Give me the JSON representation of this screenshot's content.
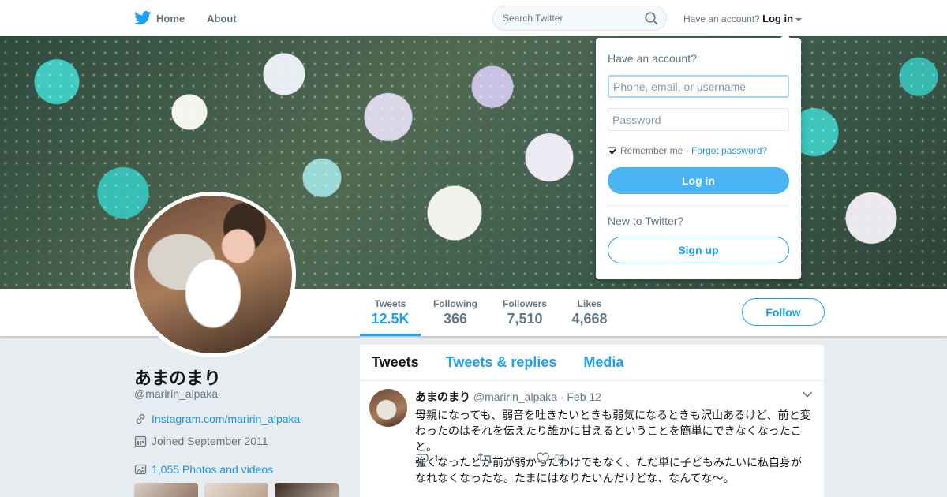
{
  "nav": {
    "home_label": "Home",
    "about_label": "About",
    "search_placeholder": "Search Twitter",
    "account_prompt": "Have an account?",
    "login_label": "Log in",
    "bird_icon": "twitter-bird-icon",
    "search_icon": "search-icon"
  },
  "profile": {
    "name": "あまのまり",
    "handle": "@maririn_alpaka",
    "website": "Instagram.com/maririn_alpaka",
    "joined": "Joined September 2011",
    "photos_videos": "1,055 Photos and videos",
    "follow_label": "Follow"
  },
  "stats": [
    {
      "label": "Tweets",
      "value": "12.5K"
    },
    {
      "label": "Following",
      "value": "366"
    },
    {
      "label": "Followers",
      "value": "7,510"
    },
    {
      "label": "Likes",
      "value": "4,668"
    }
  ],
  "timeline": {
    "tabs": [
      "Tweets",
      "Tweets & replies",
      "Media"
    ],
    "tweet": {
      "name": "あまのまり",
      "handle": "@maririn_alpaka",
      "time": "· Feb 12",
      "text_line1": "母親になっても、弱音を吐きたいときも弱気になるときも沢山あるけど、前と変わったのはそれを伝えたり誰かに甘えるということを簡単にできなくなったこと。",
      "text_line2": "強くなったとか前が弱かったわけでもなく、ただ単に子どもみたいに私自身がなれなくなったな。たまにはなりたいんだけどな、なんてな〜。",
      "replies": "1",
      "retweets": "",
      "likes": "53"
    }
  },
  "login_dropdown": {
    "title": "Have an account?",
    "username_placeholder": "Phone, email, or username",
    "password_placeholder": "Password",
    "remember_label": "Remember me ·",
    "forgot_label": "Forgot password?",
    "login_button": "Log in",
    "new_prompt": "New to Twitter?",
    "signup_button": "Sign up"
  },
  "colors": {
    "accent": "#1da1f2",
    "login_button_bg": "#4ab3f4",
    "page_bg": "#e6ecf0"
  }
}
